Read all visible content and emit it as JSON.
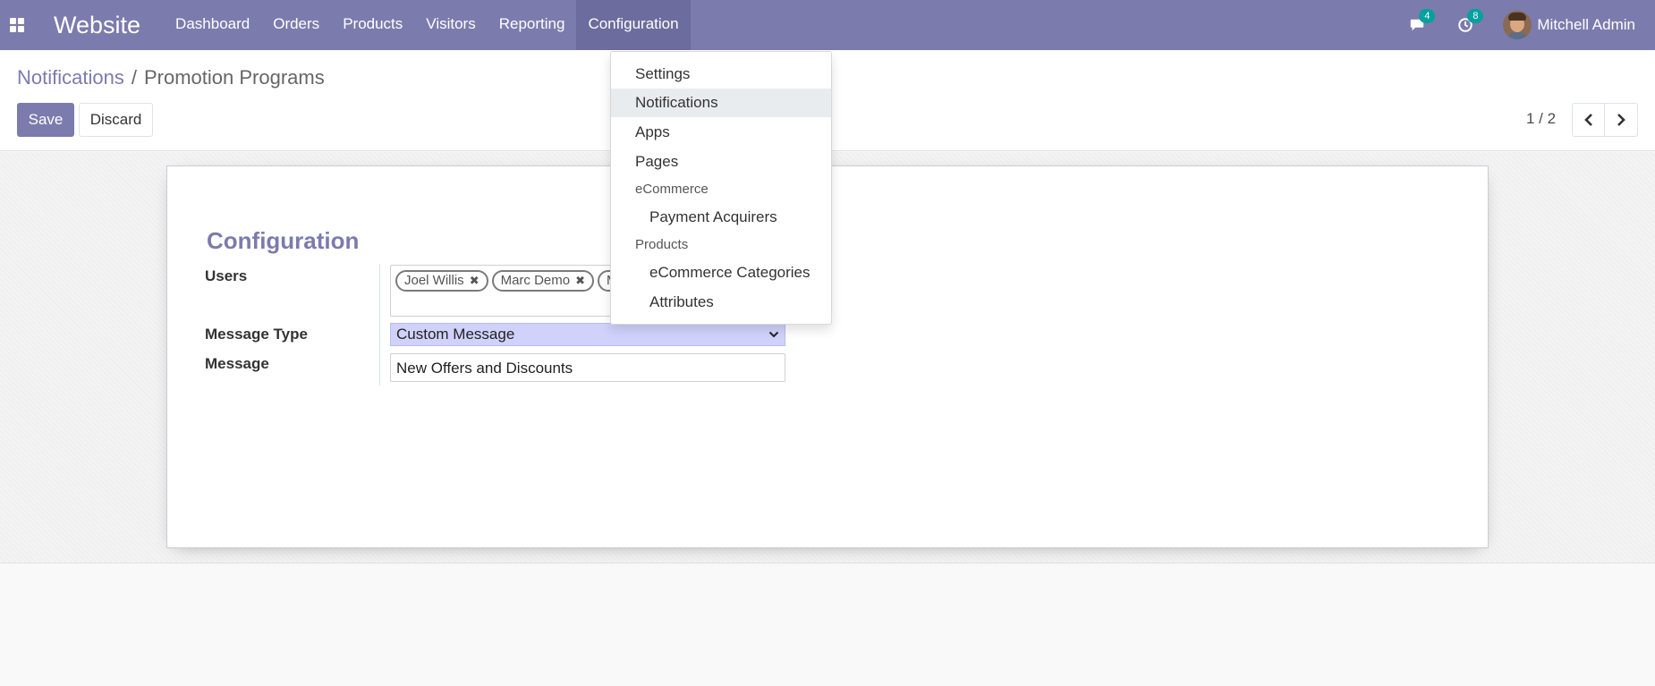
{
  "navbar": {
    "brand": "Website",
    "menu": [
      {
        "label": "Dashboard"
      },
      {
        "label": "Orders"
      },
      {
        "label": "Products"
      },
      {
        "label": "Visitors"
      },
      {
        "label": "Reporting"
      },
      {
        "label": "Configuration",
        "active": true
      }
    ],
    "messages_badge": "4",
    "activities_badge": "8",
    "user_name": "Mitchell Admin",
    "accent_color": "#7c7bad"
  },
  "breadcrumb": {
    "parent": "Notifications",
    "separator": "/",
    "current": "Promotion Programs"
  },
  "buttons": {
    "save": "Save",
    "discard": "Discard"
  },
  "pager": {
    "value": "1 / 2"
  },
  "form": {
    "group_title": "Configuration",
    "users_label": "Users",
    "users": [
      "Joel Willis",
      "Marc Demo",
      "M"
    ],
    "message_type_label": "Message Type",
    "message_type_value": "Custom Message",
    "message_label": "Message",
    "message_value": "New Offers and Discounts"
  },
  "dropdown": {
    "items": [
      {
        "label": "Settings"
      },
      {
        "label": "Notifications",
        "active": true
      },
      {
        "label": "Apps"
      },
      {
        "label": "Pages"
      }
    ],
    "header_ecommerce": "eCommerce",
    "payment_acquirers": "Payment Acquirers",
    "header_products": "Products",
    "ecommerce_categories": "eCommerce Categories",
    "attributes": "Attributes"
  }
}
